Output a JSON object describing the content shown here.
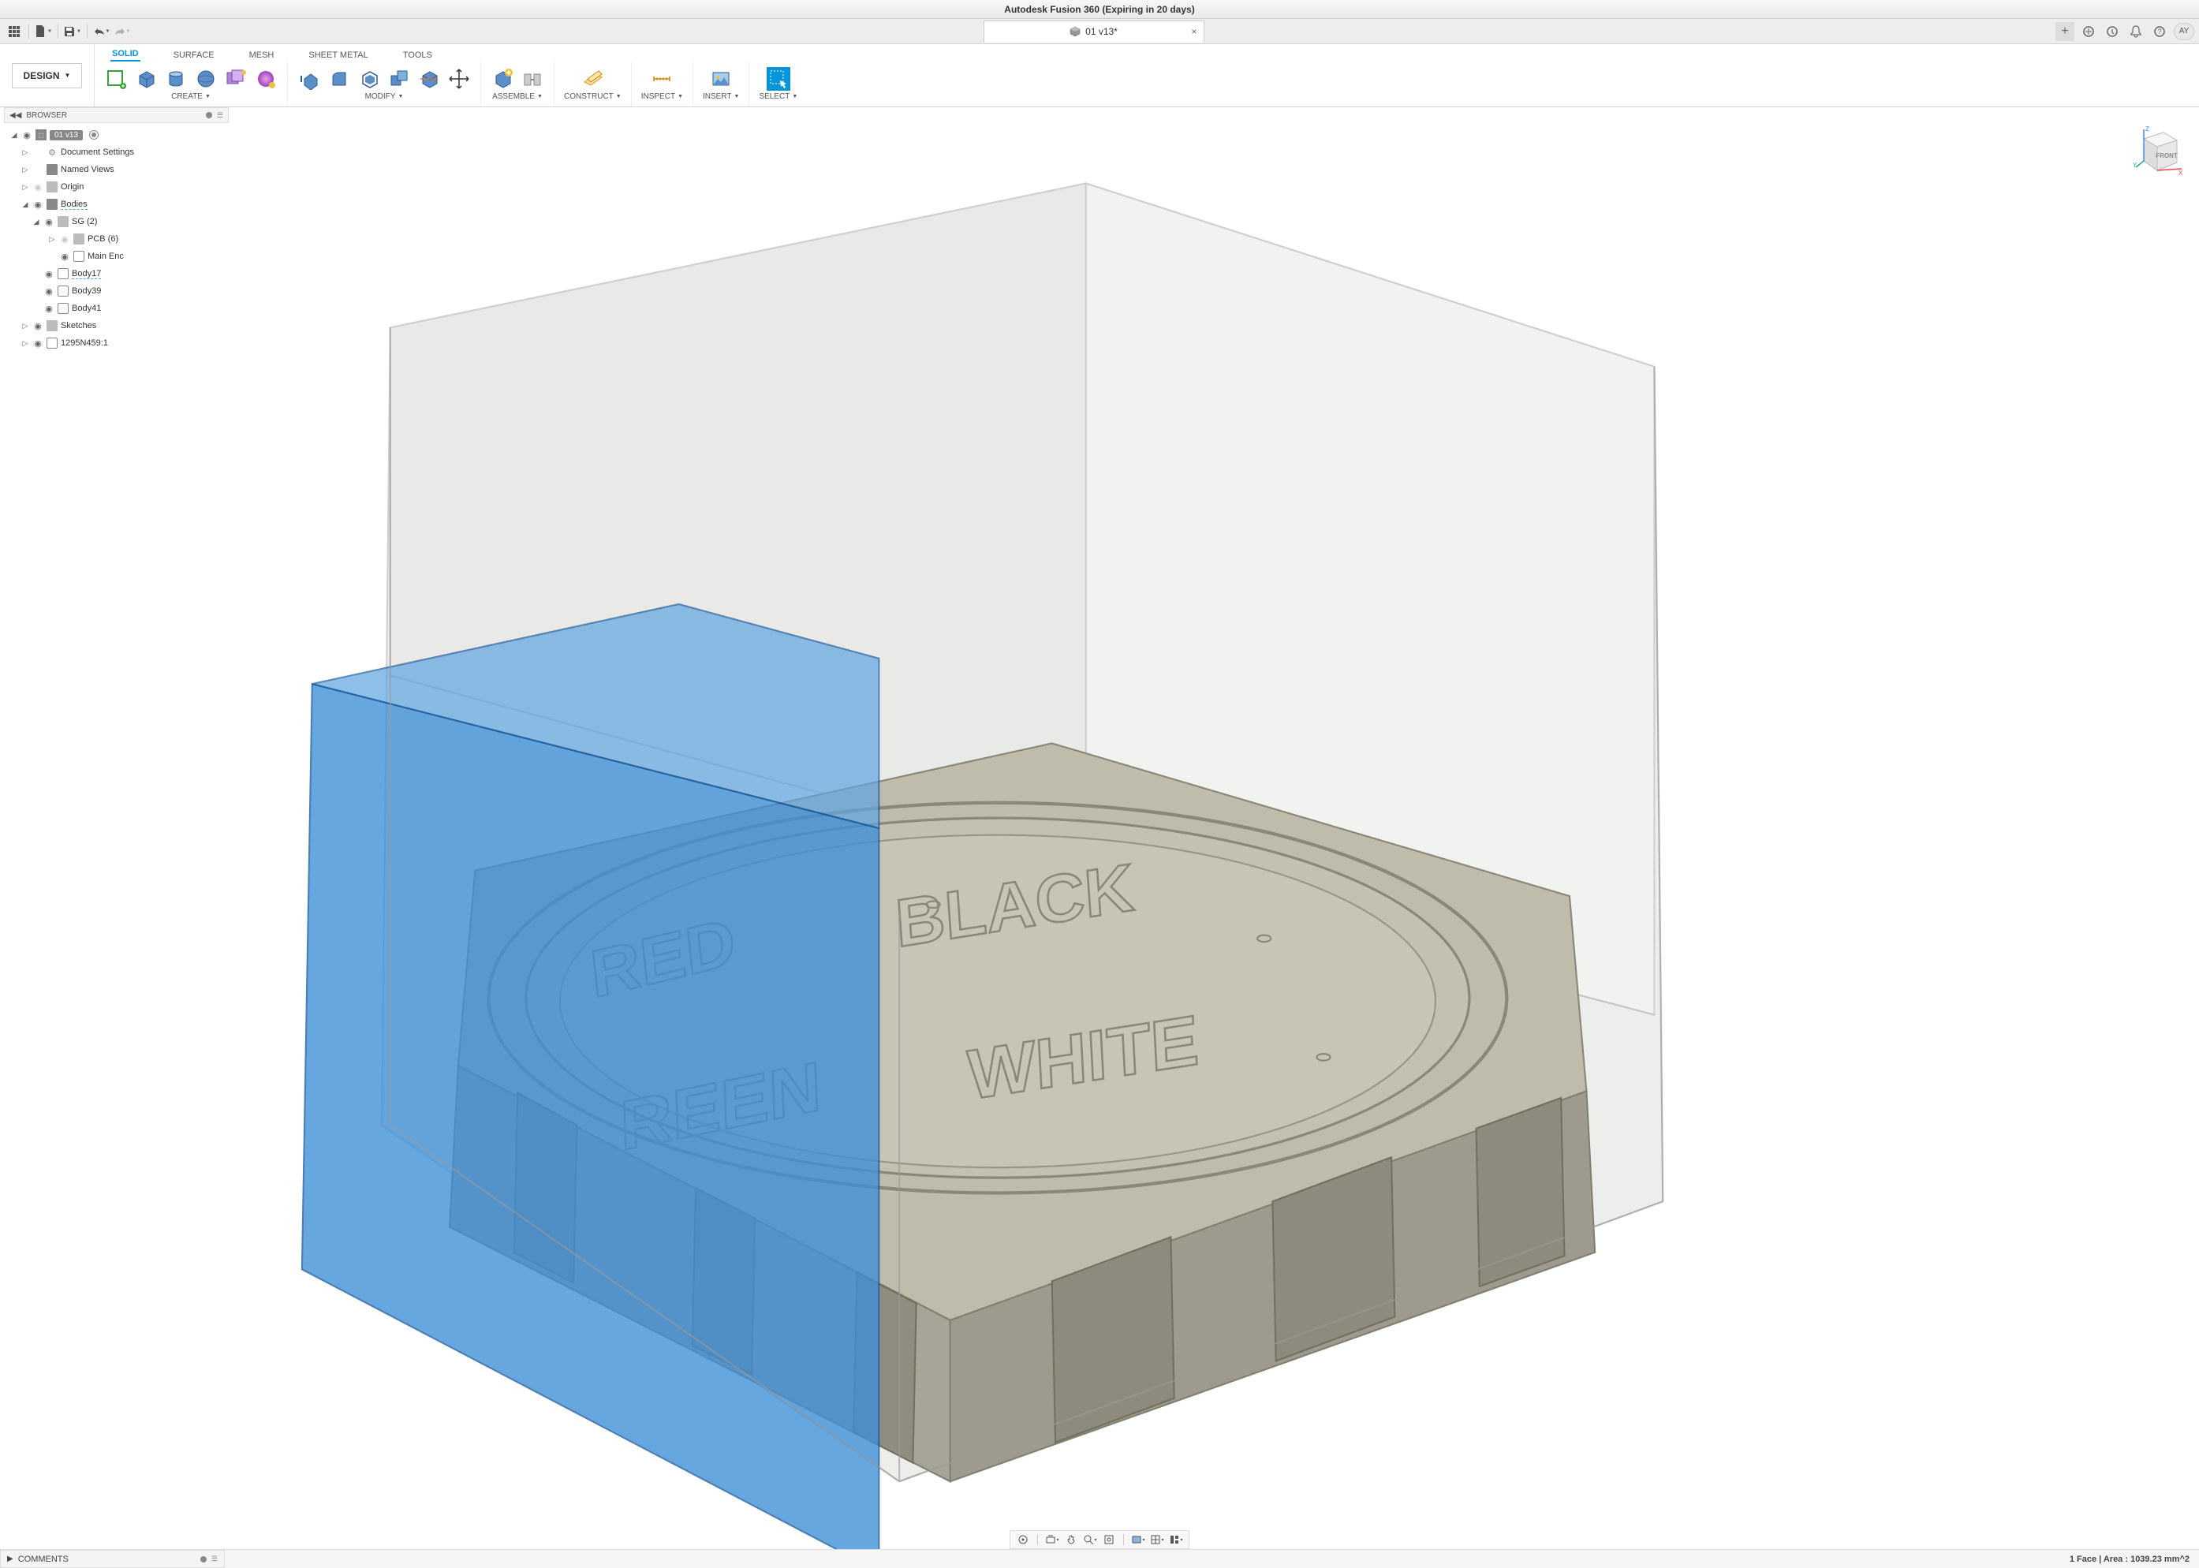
{
  "title": "Autodesk Fusion 360 (Expiring in 20 days)",
  "doc_tab": {
    "name": "01 v13*",
    "close": "×"
  },
  "qa": {
    "account_initials": "AY"
  },
  "workspace": {
    "label": "DESIGN"
  },
  "ribbon_tabs": [
    "SOLID",
    "SURFACE",
    "MESH",
    "SHEET METAL",
    "TOOLS"
  ],
  "ribbon_active_tab": "SOLID",
  "ribbon_groups": {
    "create": "CREATE",
    "modify": "MODIFY",
    "assemble": "ASSEMBLE",
    "construct": "CONSTRUCT",
    "inspect": "INSPECT",
    "insert": "INSERT",
    "select": "SELECT"
  },
  "browser": {
    "header": "BROWSER",
    "root": "01 v13",
    "items": {
      "doc_settings": "Document Settings",
      "named_views": "Named Views",
      "origin": "Origin",
      "bodies": "Bodies",
      "sg": "SG (2)",
      "pcb": "PCB (6)",
      "main_enc": "Main Enc",
      "body17": "Body17",
      "body39": "Body39",
      "body41": "Body41",
      "sketches": "Sketches",
      "comp": "1295N459:1"
    }
  },
  "viewcube": {
    "front": "FRONT",
    "z": "Z",
    "y": "Y",
    "x": "X"
  },
  "comments": {
    "label": "COMMENTS"
  },
  "status": {
    "selection": "1 Face | Area : 1039.23 mm^2"
  },
  "model_text": {
    "red": "RED",
    "black": "BLACK",
    "green": "REEN",
    "white": "WHITE"
  }
}
